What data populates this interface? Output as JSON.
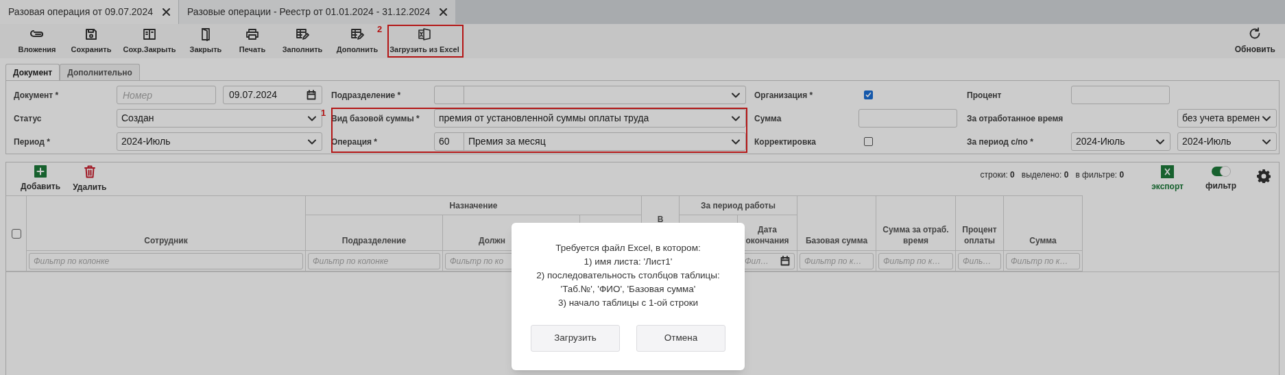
{
  "tabs": [
    {
      "title": "Разовая операция от 09.07.2024",
      "selected": true
    },
    {
      "title": "Разовые операции - Реестр от 01.01.2024 - 31.12.2024",
      "selected": false
    }
  ],
  "toolbar": {
    "buttons": [
      {
        "label": "Вложения",
        "kind": "attach"
      },
      {
        "label": "Сохранить",
        "kind": "save"
      },
      {
        "label": "Сохр.Закрыть",
        "kind": "save_close"
      },
      {
        "label": "Закрыть",
        "kind": "close"
      },
      {
        "label": "Печать",
        "kind": "print"
      },
      {
        "label": "Заполнить",
        "kind": "fill"
      },
      {
        "label": "Дополнить",
        "kind": "fill"
      },
      {
        "label": "Загрузить из Excel",
        "kind": "excel"
      }
    ],
    "refresh": {
      "label": "Обновить"
    }
  },
  "annotations": [
    {
      "label": "2"
    },
    {
      "label": "1"
    }
  ],
  "form_tabs": [
    {
      "label": "Документ",
      "selected": true
    },
    {
      "label": "Дополнительно",
      "selected": false
    }
  ],
  "form": {
    "rows": [
      {
        "groups": [
          {
            "label": "Документ *",
            "fields": [
              {
                "kind": "input",
                "placeholder": "Номер"
              },
              {
                "kind": "date",
                "value": "09.07.2024"
              }
            ]
          },
          {
            "label": "Подразделение *",
            "fields": [
              {
                "kind": "code_select"
              }
            ]
          },
          {
            "label": "Организация *",
            "fields": [
              {
                "kind": "checkbox",
                "checked": true
              }
            ]
          },
          {
            "label": "Процент",
            "fields": [
              {
                "kind": "input"
              }
            ]
          }
        ]
      },
      {
        "groups": [
          {
            "label": "Статус",
            "fields": [
              {
                "kind": "select",
                "value": "Создан"
              }
            ]
          },
          {
            "label": "Вид базовой суммы *",
            "fields": [
              {
                "kind": "select",
                "value": "премия от установленной суммы оплаты труда"
              }
            ]
          },
          {
            "label": "Сумма",
            "fields": [
              {
                "kind": "input"
              }
            ]
          },
          {
            "label": "За отработанное время",
            "fields": [
              {
                "kind": "select",
                "value": "без учета времен"
              }
            ]
          }
        ]
      },
      {
        "groups": [
          {
            "label": "Период *",
            "fields": [
              {
                "kind": "select",
                "value": "2024-Июль"
              }
            ]
          },
          {
            "label": "Операция *",
            "fields": [
              {
                "kind": "code_select",
                "code": "60",
                "value": "Премия за месяц"
              }
            ]
          },
          {
            "label": "Корректировка",
            "fields": [
              {
                "kind": "checkbox",
                "checked": false
              }
            ]
          },
          {
            "label": "За период с/по *",
            "fields": [
              {
                "kind": "select",
                "value": "2024-Июль"
              },
              {
                "kind": "select",
                "value": "2024-Июль"
              }
            ]
          }
        ]
      }
    ]
  },
  "grid_toolbar": {
    "buttons": [
      {
        "label": "Добавить",
        "kind": "add"
      },
      {
        "label": "Удалить",
        "kind": "delete"
      }
    ],
    "counters": [
      "строки: **0**",
      "выделено: **0**",
      "в фильтре: **0**"
    ],
    "export": {
      "label": "экспорт"
    },
    "filter_toggle": {
      "label": "фильтр",
      "on": true
    }
  },
  "table": {
    "select_all_checked": false,
    "columns": [
      {
        "title": "Сотрудник",
        "filter": "Фильтр по колонке"
      },
      {
        "title": "Назначение",
        "children": [
          {
            "title": "Подразделение",
            "filter": "Фильтр по колонке"
          },
          {
            "title": "Должн",
            "filter": "Фильтр по ко",
            "kind": "cut"
          },
          {
            "kind": "hidden"
          }
        ]
      },
      {
        "title": "В",
        "kind": "partial"
      },
      {
        "title": "За период работы",
        "children": [
          {
            "kind": "hidden"
          },
          {
            "title": "Дата окончания",
            "filter": "Фил…",
            "filter_calendar": true
          }
        ]
      },
      {
        "title": "Базовая сумма",
        "filter": "Фильтр по к…"
      },
      {
        "title": "Сумма за отраб. время",
        "filter": "Фильтр по к…"
      },
      {
        "title": "Процент оплаты",
        "filter": "Филь…"
      },
      {
        "title": "Сумма",
        "filter": "Фильтр по к…"
      }
    ]
  },
  "dialog": {
    "message": "Требуется файл Excel, в котором:\n1) имя листа: 'Лист1'\n2) последовательность столбцов таблицы:\n'Таб.№', 'ФИО', 'Базовая сумма'\n3) начало таблицы с 1-ой строки",
    "buttons": [
      "Загрузить",
      "Отмена"
    ]
  }
}
